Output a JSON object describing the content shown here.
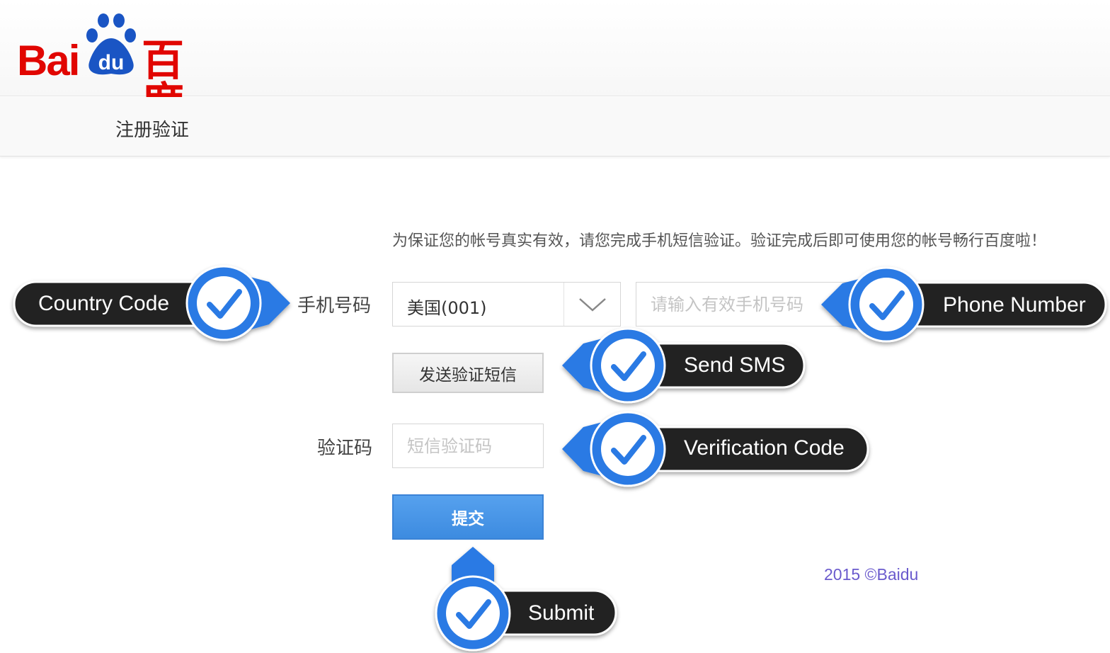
{
  "header": {
    "logo_latin_1": "Bai",
    "logo_paw_text": "du",
    "logo_chinese": "百度"
  },
  "page": {
    "title": "注册验证",
    "intro": "为保证您的帐号真实有效，请您完成手机短信验证。验证完成后即可使用您的帐号畅行百度啦！"
  },
  "form": {
    "phone_label": "手机号码",
    "country_selected": "美国(001)",
    "phone_placeholder": "请输入有效手机号码",
    "send_sms_button": "发送验证短信",
    "code_label": "验证码",
    "code_placeholder": "短信验证码",
    "submit_button": "提交"
  },
  "footer": {
    "copyright": "2015 ©Baidu"
  },
  "annotations": {
    "country_code": "Country Code",
    "phone_number": "Phone Number",
    "send_sms": "Send SMS",
    "verification_code": "Verification Code",
    "submit": "Submit"
  },
  "colors": {
    "brand_red": "#e10601",
    "brand_blue": "#1a55c4",
    "annotation_blue": "#2a7ae4",
    "annotation_dark": "#222222",
    "submit_blue": "#4592e6",
    "footer_purple": "#6a5acd"
  }
}
